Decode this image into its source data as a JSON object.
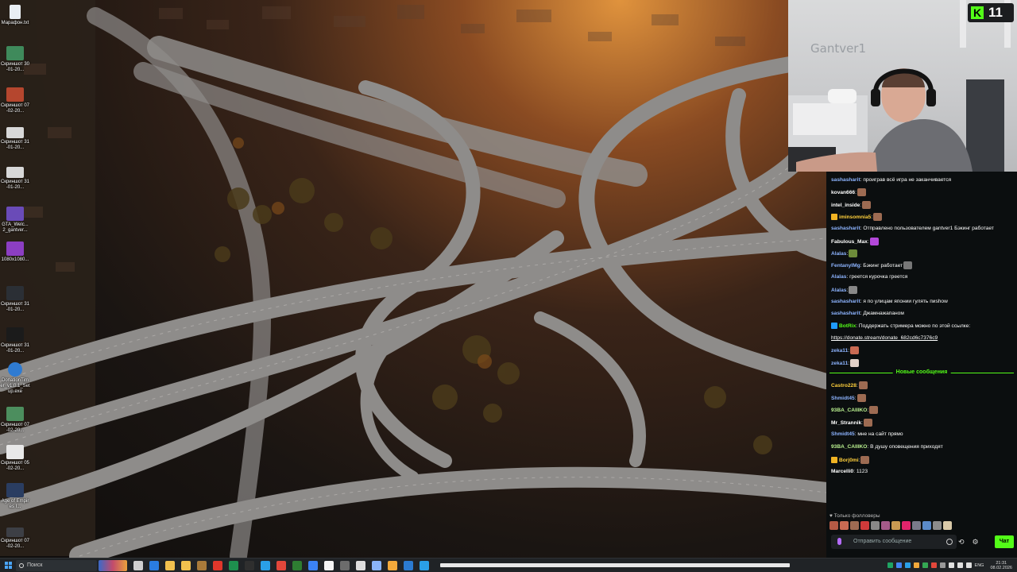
{
  "desktop_icons": [
    {
      "label": "Марафон.txt",
      "color": "#e9eef3"
    },
    {
      "label": "Скриншот 30-01-20...",
      "color": "#3f8a5b"
    },
    {
      "label": "Скриншот 07-02-20...",
      "color": "#b5462e"
    },
    {
      "label": "Скриншот 31-01-20...",
      "color": "#d8d8d8"
    },
    {
      "label": "Скриншот 31-01-20...",
      "color": "#d8d8d8"
    },
    {
      "label": "GTA_Welc... 2_gantver...",
      "color": "#6a4bb8"
    },
    {
      "label": "1080x1080...",
      "color": "#8c3ec2"
    },
    {
      "label": "Скриншот 31-01-20...",
      "color": "#2b2f35"
    },
    {
      "label": "Скриншот 31-01-20...",
      "color": "#1b1b1b"
    },
    {
      "label": "DonationTim er_v1.0.1_Set up.exe",
      "color": "#2f7bd1"
    },
    {
      "label": "Скриншот 07-02-20...",
      "color": "#4c8e5e"
    },
    {
      "label": "Скриншот 05-02-20...",
      "color": "#e8e8e8"
    },
    {
      "label": "Age of Empires I...",
      "color": "#2a3d61"
    },
    {
      "label": "Скриншот 07-02-20...",
      "color": "#3d3f45"
    }
  ],
  "webcam": {
    "wall_text": "Gantver1",
    "kick_logo": "K",
    "viewer_count": "11"
  },
  "chat": {
    "messages": [
      {
        "user": "sashasharit",
        "user_color": "#8db4ff",
        "text": ": проиграв всё игра не заканчивается",
        "emote": ""
      },
      {
        "user": "kovan666",
        "user_color": "#ffffff",
        "text": ":",
        "emote": "#9d6b52"
      },
      {
        "user": "intel_inside",
        "user_color": "#ffffff",
        "text": ":",
        "emote": "#9d6b52"
      },
      {
        "user": "iminsomnia5",
        "user_color": "#ffd03c",
        "text": ":",
        "emote": "#9d6b52",
        "badge": "#f0b323"
      },
      {
        "user": "sashasharit",
        "user_color": "#8db4ff",
        "text": ": Отправлено пользователем gantver1 Бэкинг работает",
        "emote": ""
      },
      {
        "user": "Fabulous_Max",
        "user_color": "#ffffff",
        "text": ":",
        "emote": "#b348d9"
      },
      {
        "user": "Alalas",
        "user_color": "#8db4ff",
        "text": ":",
        "emote": "#6d8b3a"
      },
      {
        "user": "FentanylMg",
        "user_color": "#8db4ff",
        "text": ": Бэкинг работает",
        "emote": "#777777"
      },
      {
        "user": "Alalas",
        "user_color": "#8db4ff",
        "text": ": греется курочка греется",
        "emote": ""
      },
      {
        "user": "Alalas",
        "user_color": "#8db4ff",
        "text": ":",
        "emote": "#888888"
      },
      {
        "user": "sashasharit",
        "user_color": "#8db4ff",
        "text": ": я по улицам японии гулять пиshow",
        "emote": ""
      },
      {
        "user": "sashasharit",
        "user_color": "#8db4ff",
        "text": ": Джамнажапаном",
        "emote": ""
      },
      {
        "user": "BotRix",
        "user_color": "#53fc18",
        "text": ": Поддержать стримера можно по этой ссылке:",
        "emote": "",
        "badge": "#1f9bff"
      },
      {
        "user": "",
        "user_color": "#ffffff",
        "text": "https://donate.stream/donate_682cd6c7376c9",
        "emote": "",
        "link": true
      },
      {
        "user": "zeka11",
        "user_color": "#8db4ff",
        "text": ":",
        "emote": "#c96a52"
      },
      {
        "user": "zeka11",
        "user_color": "#8db4ff",
        "text": ":",
        "emote": "#e3d2c8"
      }
    ],
    "new_messages_label": "Новые сообщения",
    "new_messages": [
      {
        "user": "Castro228",
        "user_color": "#ffd03c",
        "text": ":",
        "emote": "#9d6b52"
      },
      {
        "user": "Shmidt45",
        "user_color": "#8db4ff",
        "text": ":",
        "emote": "#9d6b52"
      },
      {
        "user": "93BA_CAIIIKO",
        "user_color": "#b9f08f",
        "text": ":",
        "emote": "#9d6b52"
      },
      {
        "user": "Mr_Strannik",
        "user_color": "#ffffff",
        "text": ":",
        "emote": "#9d6b52"
      },
      {
        "user": "Shmidt45",
        "user_color": "#8db4ff",
        "text": ": мне на сайт прямо",
        "emote": ""
      },
      {
        "user": "93BA_CAIIIKO",
        "user_color": "#b9f08f",
        "text": ": В душу оповещения приходят",
        "emote": ""
      },
      {
        "user": "Borj0mi",
        "user_color": "#ffd03c",
        "text": ":",
        "emote": "#9d6b52",
        "badge": "#f0b323"
      },
      {
        "user": "Marcelli0",
        "user_color": "#ffffff",
        "text": ": 1123",
        "emote": ""
      }
    ],
    "followers_only": "♥ Только фолловеры",
    "input_placeholder": "Отправить сообщение",
    "send_label": "Чат",
    "emote_colors": [
      "#b55a45",
      "#c96a52",
      "#9d6b52",
      "#d03a3a",
      "#888888",
      "#a45a8a",
      "#c99a52",
      "#e0246b",
      "#7a7a8a",
      "#5a8ac9",
      "#8c8c8c",
      "#d9c9a8"
    ]
  },
  "taskbar": {
    "search_label": "Поиск",
    "app_colors": [
      "#cfcfcf",
      "#2a7de1",
      "#f2c14e",
      "#f2c14e",
      "#a87a3a",
      "#e0372b",
      "#1e8f4e",
      "#2f2f2f",
      "#2aa0e8",
      "#e2473b",
      "#2e7d32",
      "#3b82f6",
      "#f5f5f5",
      "#6c6c6c",
      "#dddddd",
      "#8ab4f8",
      "#f2a93b",
      "#2b7bd1",
      "#2aa0e8"
    ],
    "tray_colors": [
      "#1fa463",
      "#4285f4",
      "#2aa0e8",
      "#f2a93b",
      "#34a853",
      "#e2473b",
      "#999999",
      "#e0e0e0",
      "#e0e0e0",
      "#e0e0e0"
    ],
    "language": "ENG",
    "time": "21:31",
    "date": "08.02.2026"
  }
}
